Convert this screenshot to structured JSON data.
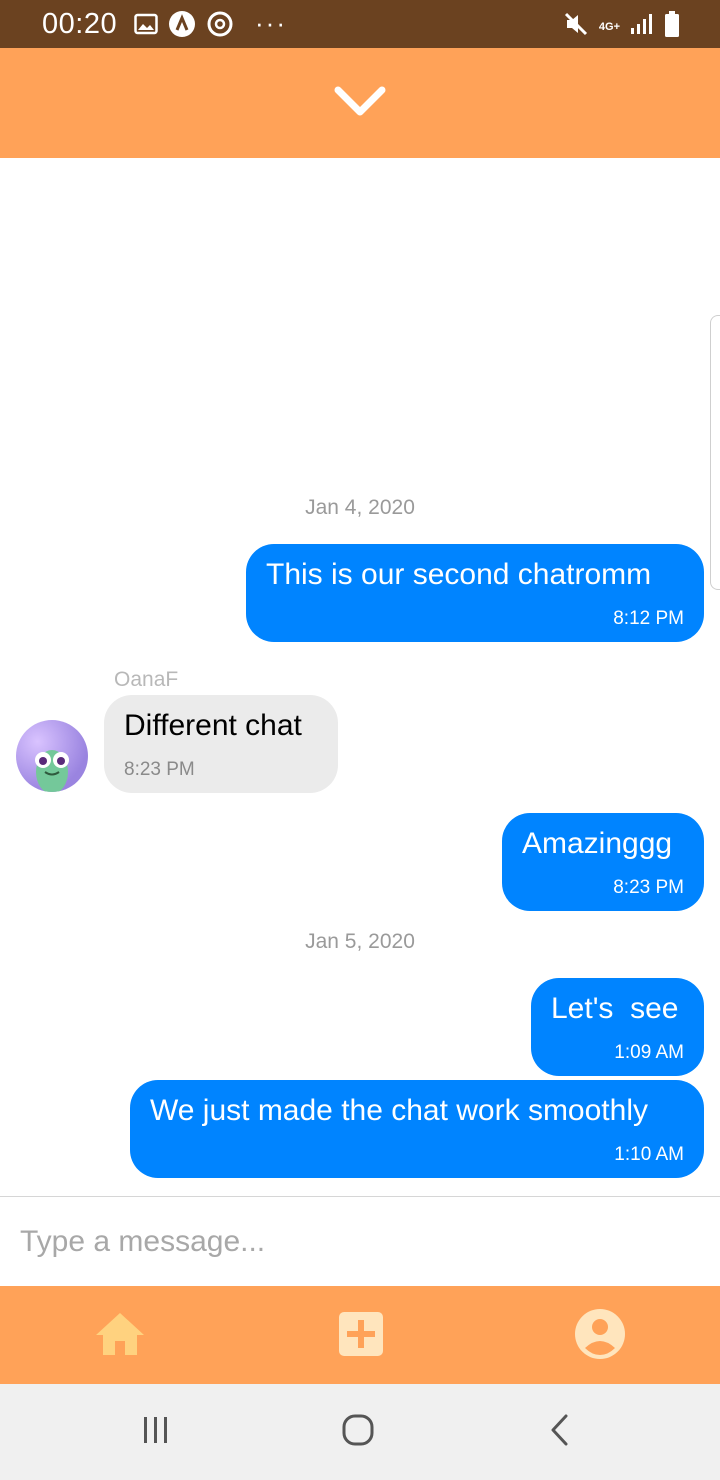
{
  "status_bar": {
    "time": "00:20",
    "network": "4G+",
    "overflow": "···",
    "icons": [
      "image-icon",
      "a-circle-icon",
      "sync-circle-icon",
      "mute-icon",
      "signal-icon",
      "battery-icon"
    ]
  },
  "header": {
    "collapse_icon": "chevron-down-icon",
    "background": "#ffa258"
  },
  "chat": {
    "groups": [
      {
        "date": "Jan 4, 2020",
        "messages": [
          {
            "direction": "outgoing",
            "text": "This is our second chatromm",
            "time": "8:12 PM"
          },
          {
            "direction": "incoming",
            "sender": "OanaF",
            "text": "Different chat",
            "time": "8:23 PM"
          },
          {
            "direction": "outgoing",
            "text": "Amazinggg",
            "time": "8:23 PM"
          }
        ]
      },
      {
        "date": "Jan 5, 2020",
        "messages": [
          {
            "direction": "outgoing",
            "text": "Let's  see",
            "time": "1:09 AM"
          },
          {
            "direction": "outgoing",
            "text": "We just made the chat work smoothly",
            "time": "1:10 AM"
          }
        ]
      }
    ],
    "outgoing_color": "#0084ff",
    "incoming_color": "#ebebeb"
  },
  "composer": {
    "placeholder": "Type a message...",
    "value": ""
  },
  "tab_bar": {
    "tabs": [
      {
        "name": "home",
        "icon": "home-icon"
      },
      {
        "name": "new",
        "icon": "plus-square-icon"
      },
      {
        "name": "profile",
        "icon": "user-circle-icon"
      }
    ],
    "icon_color": "#ffd27f",
    "background": "#ffa258"
  },
  "system_nav": {
    "buttons": [
      "recents-icon",
      "home-circle-icon",
      "back-icon"
    ]
  }
}
